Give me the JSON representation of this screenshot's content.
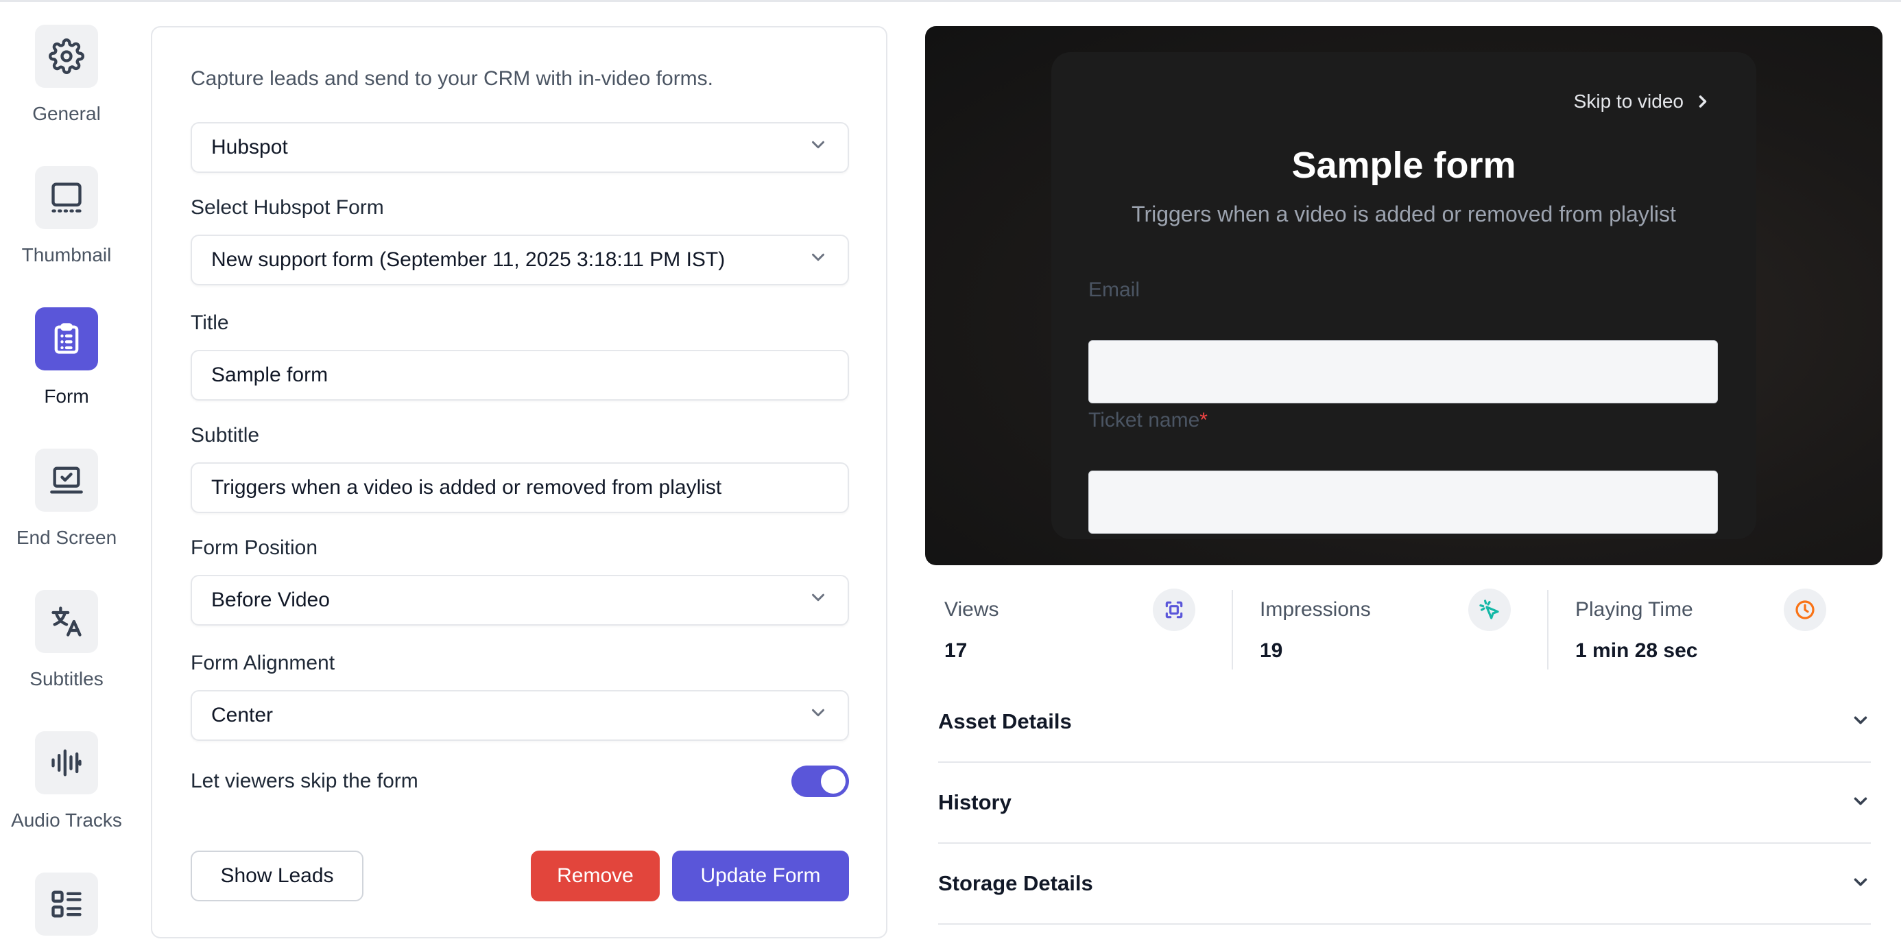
{
  "sidebar": {
    "items": [
      {
        "label": "General",
        "icon": "gear-icon"
      },
      {
        "label": "Thumbnail",
        "icon": "thumbnail-icon"
      },
      {
        "label": "Form",
        "icon": "clipboard-icon",
        "active": true
      },
      {
        "label": "End Screen",
        "icon": "laptop-check-icon"
      },
      {
        "label": "Subtitles",
        "icon": "translate-icon"
      },
      {
        "label": "Audio Tracks",
        "icon": "waveform-icon"
      },
      {
        "label": "",
        "icon": "list-layout-icon"
      }
    ]
  },
  "form": {
    "intro": "Capture leads and send to your CRM with in-video forms.",
    "provider": "Hubspot",
    "hubspot_form_label": "Select Hubspot Form",
    "hubspot_form_value": "New support form (September 11, 2025 3:18:11 PM IST)",
    "title_label": "Title",
    "title_value": "Sample form",
    "subtitle_label": "Subtitle",
    "subtitle_value": "Triggers when a video is added or removed from playlist",
    "position_label": "Form Position",
    "position_value": "Before Video",
    "alignment_label": "Form Alignment",
    "alignment_value": "Center",
    "skip_label": "Let viewers skip the form",
    "skip_enabled": true,
    "show_leads": "Show Leads",
    "remove": "Remove",
    "update": "Update Form"
  },
  "preview": {
    "skip": "Skip to video",
    "title": "Sample form",
    "subtitle": "Triggers when a video is added or removed from playlist",
    "fields": [
      {
        "label": "Email",
        "required": false
      },
      {
        "label": "Ticket name",
        "required": true
      }
    ],
    "required_mark": "*"
  },
  "stats": [
    {
      "label": "Views",
      "value": "17",
      "icon": "scan-icon",
      "color": "#5a56d9"
    },
    {
      "label": "Impressions",
      "value": "19",
      "icon": "cursor-click-icon",
      "color": "#14b8a6"
    },
    {
      "label": "Playing Time",
      "value": "1 min 28 sec",
      "icon": "clock-icon",
      "color": "#f97316"
    }
  ],
  "accordions": [
    "Asset Details",
    "History",
    "Storage Details"
  ],
  "colors": {
    "accent": "#5a56d9",
    "danger": "#e2453c"
  }
}
